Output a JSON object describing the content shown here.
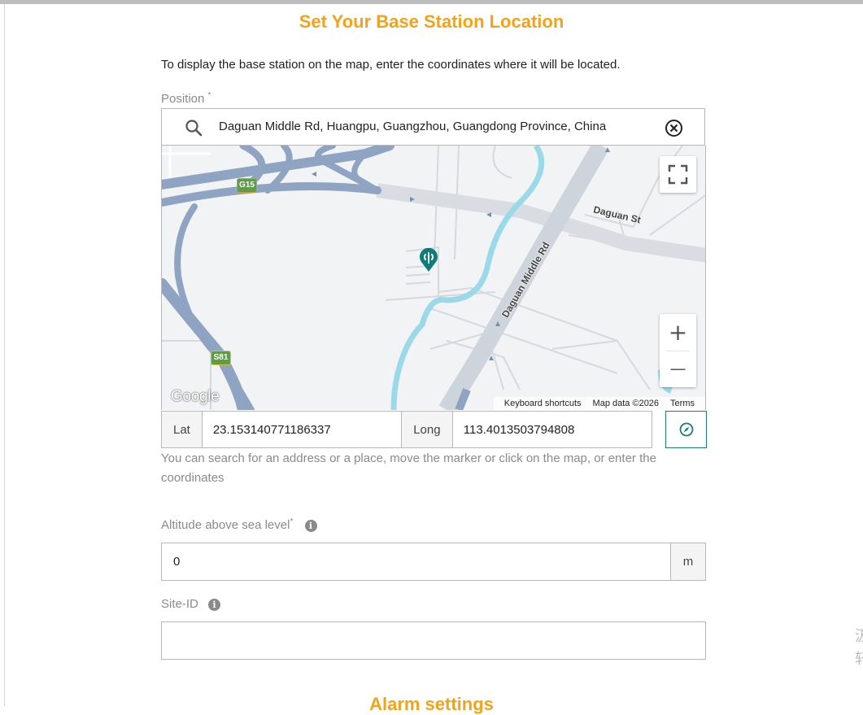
{
  "page": {
    "title": "Set Your Base Station Location",
    "intro": "To display the base station on the map, enter the coordinates where it will be located.",
    "next_section_title": "Alarm settings"
  },
  "position": {
    "label": "Position",
    "required_mark": "*",
    "search_value": "Daguan Middle Rd, Huangpu, Guangzhou, Guangdong Province, China"
  },
  "map": {
    "provider_logo": "Google",
    "keyboard_shortcuts": "Keyboard shortcuts",
    "map_data": "Map data ©2026",
    "terms": "Terms",
    "street_labels": [
      "Daguan St",
      "Daguan Middle Rd"
    ],
    "shields": [
      "G15",
      "S81"
    ],
    "zoom_in": "+",
    "zoom_out": "—",
    "colors": {
      "water": "#9ad9e8",
      "highway": "#8ea4c2",
      "road": "#d9dde3",
      "marker": "#0f7c7c"
    }
  },
  "coordinates": {
    "lat_label": "Lat",
    "lat_value": "23.153140771186337",
    "long_label": "Long",
    "long_value": "113.4013503794808",
    "locate_icon": "compass-icon"
  },
  "help_text": "You can search for an address or a place, move the marker or click on the map, or enter the coordinates",
  "altitude": {
    "label": "Altitude above sea level",
    "required_mark": "*",
    "info_icon": "i",
    "value": "0",
    "unit": "m"
  },
  "site_id": {
    "label": "Site-ID",
    "info_icon": "i",
    "value": ""
  },
  "side_glyphs": [
    "汲",
    "轩"
  ],
  "colors": {
    "accent": "#f5a21a",
    "teal": "#1b7c7c"
  }
}
